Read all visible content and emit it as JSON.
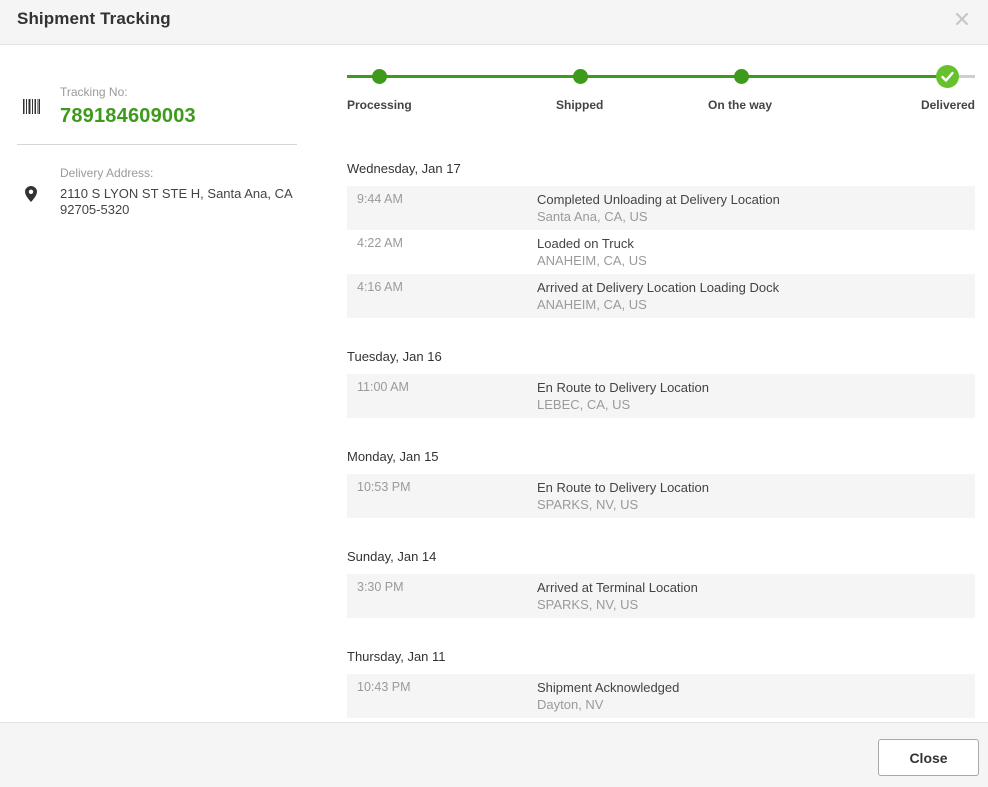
{
  "header": {
    "title": "Shipment Tracking",
    "close_icon": "close-icon"
  },
  "tracking": {
    "label": "Tracking No:",
    "number": "789184609003",
    "icon": "barcode-icon"
  },
  "delivery": {
    "label": "Delivery Address:",
    "address": "2110 S LYON ST STE H, Santa Ana, CA 92705-5320",
    "icon": "map-pin-icon"
  },
  "progress": {
    "steps": [
      {
        "label": "Processing",
        "done": true
      },
      {
        "label": "Shipped",
        "done": true
      },
      {
        "label": "On the way",
        "done": true
      },
      {
        "label": "Delivered",
        "done": true,
        "current": true
      }
    ],
    "completed_fraction": 0.955,
    "colors": {
      "done": "#3d9a1b",
      "current": "#66c22b",
      "pending": "#cfcfcf"
    }
  },
  "timeline": [
    {
      "date": "Wednesday, Jan 17",
      "events": [
        {
          "time": "9:44 AM",
          "title": "Completed Unloading at Delivery Location",
          "location": "Santa Ana, CA, US"
        },
        {
          "time": "4:22 AM",
          "title": "Loaded on Truck",
          "location": "ANAHEIM, CA, US"
        },
        {
          "time": "4:16 AM",
          "title": "Arrived at Delivery Location Loading Dock",
          "location": "ANAHEIM, CA, US"
        }
      ]
    },
    {
      "date": "Tuesday, Jan 16",
      "events": [
        {
          "time": "11:00 AM",
          "title": "En Route to Delivery Location",
          "location": "LEBEC, CA, US"
        }
      ]
    },
    {
      "date": "Monday, Jan 15",
      "events": [
        {
          "time": "10:53 PM",
          "title": "En Route to Delivery Location",
          "location": "SPARKS, NV, US"
        }
      ]
    },
    {
      "date": "Sunday, Jan 14",
      "events": [
        {
          "time": "3:30 PM",
          "title": "Arrived at Terminal Location",
          "location": "SPARKS, NV, US"
        }
      ]
    },
    {
      "date": "Thursday, Jan 11",
      "events": [
        {
          "time": "10:43 PM",
          "title": "Shipment Acknowledged",
          "location": "Dayton, NV"
        }
      ]
    }
  ],
  "footer": {
    "close_label": "Close"
  }
}
